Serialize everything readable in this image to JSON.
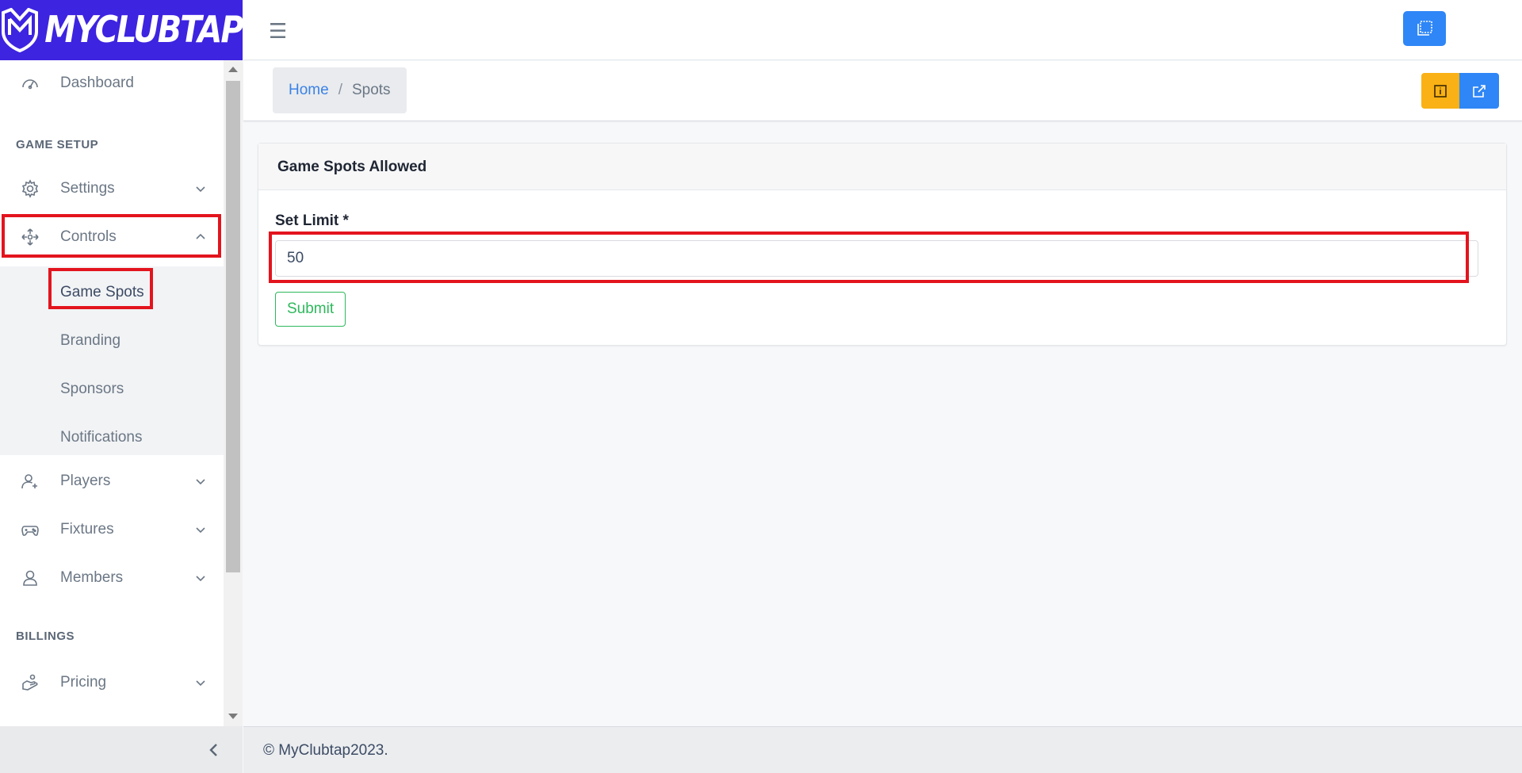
{
  "brand": {
    "name": "MYCLUBTAP",
    "logo_icon": "my-shield-logo"
  },
  "colors": {
    "brand": "#3d24e0",
    "primary": "#2f86f6",
    "warning": "#f9b115",
    "success": "#2eb85c",
    "highlight": "#e3141d"
  },
  "sidebar": {
    "dashboard": {
      "label": "Dashboard",
      "icon": "speedometer-icon"
    },
    "section_game_setup": "GAME SETUP",
    "settings": {
      "label": "Settings",
      "icon": "gear-icon"
    },
    "controls": {
      "label": "Controls",
      "icon": "move-arrows-icon",
      "children": [
        "Game Spots",
        "Branding",
        "Sponsors",
        "Notifications"
      ],
      "active_child": "Game Spots"
    },
    "players": {
      "label": "Players",
      "icon": "user-plus-icon"
    },
    "fixtures": {
      "label": "Fixtures",
      "icon": "gamepad-icon"
    },
    "members": {
      "label": "Members",
      "icon": "user-icon"
    },
    "section_billings": "BILLINGS",
    "pricing": {
      "label": "Pricing",
      "icon": "hand-coin-icon"
    }
  },
  "header": {
    "menu_icon": "hamburger-icon",
    "action_icon": "copy-window-icon"
  },
  "breadcrumb": {
    "home": "Home",
    "separator": "/",
    "current": "Spots"
  },
  "toolbar": {
    "info_icon": "info-box-icon",
    "open_icon": "external-link-icon"
  },
  "card": {
    "title": "Game Spots Allowed",
    "field_label": "Set Limit *",
    "limit_value": "50",
    "submit_label": "Submit"
  },
  "footer": {
    "text": "© MyClubtap2023."
  }
}
